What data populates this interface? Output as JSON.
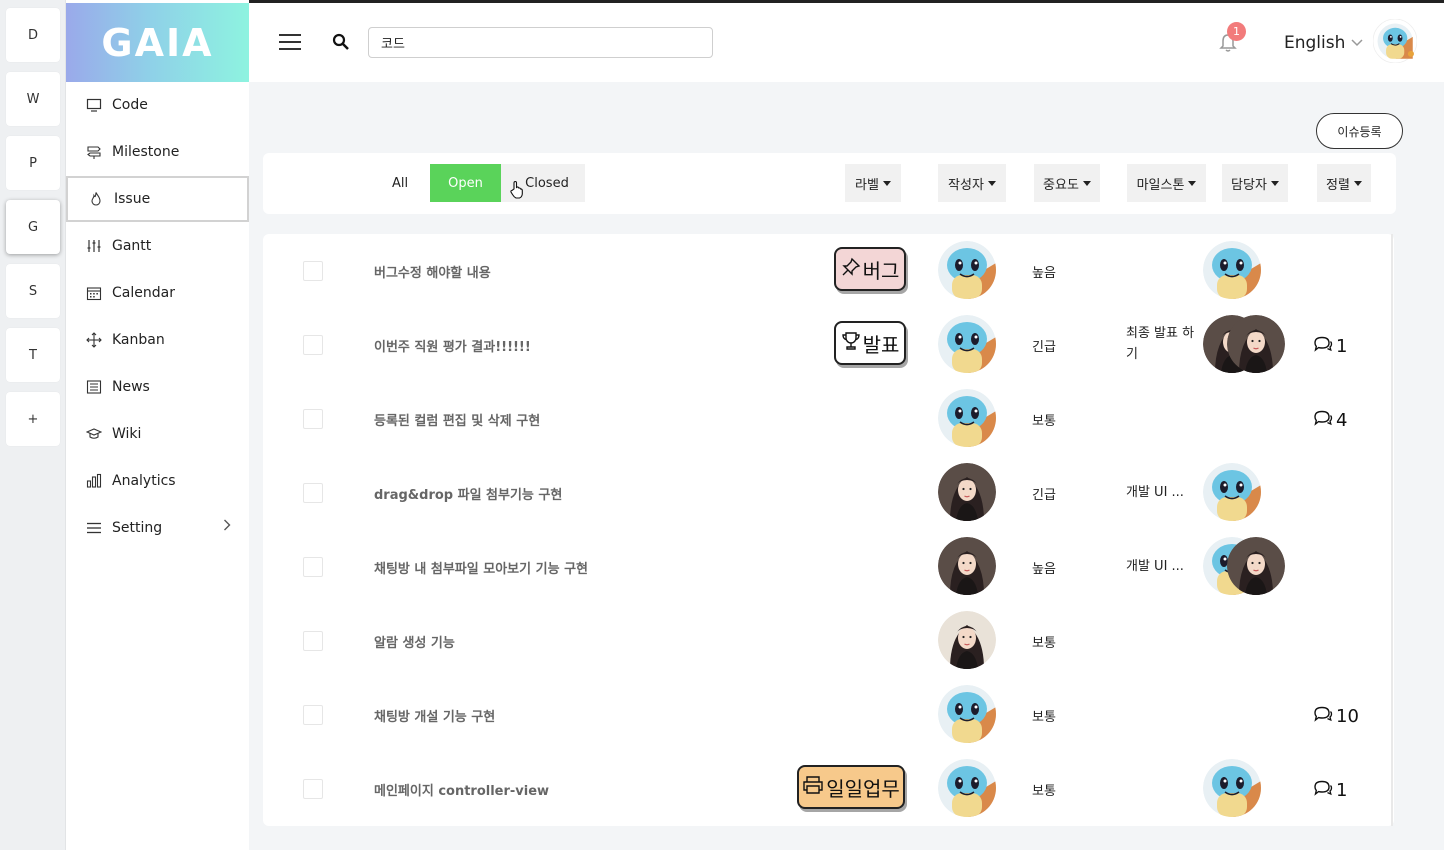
{
  "workspaces": [
    "D",
    "W",
    "P",
    "G",
    "S",
    "T",
    "+"
  ],
  "logo": "GAIA",
  "sidebar": {
    "items": [
      {
        "label": "Code",
        "icon": "monitor-icon"
      },
      {
        "label": "Milestone",
        "icon": "signpost-icon"
      },
      {
        "label": "Issue",
        "icon": "flame-icon"
      },
      {
        "label": "Gantt",
        "icon": "sliders-icon"
      },
      {
        "label": "Calendar",
        "icon": "calendar-icon"
      },
      {
        "label": "Kanban",
        "icon": "move-icon"
      },
      {
        "label": "News",
        "icon": "newspaper-icon"
      },
      {
        "label": "Wiki",
        "icon": "graduation-cap-icon"
      },
      {
        "label": "Analytics",
        "icon": "bar-chart-icon"
      },
      {
        "label": "Setting",
        "icon": "menu-icon"
      }
    ],
    "active": "Issue"
  },
  "topbar": {
    "search_value": "코드",
    "notification_count": "1",
    "language": "English"
  },
  "register_button": "이슈등록",
  "filters": {
    "all": "All",
    "open": "Open",
    "closed": "Closed",
    "dropdowns": [
      "라벨",
      "작성자",
      "중요도",
      "마일스톤",
      "담당자",
      "정렬"
    ]
  },
  "issues": [
    {
      "title": "버그수정 해야할 내용",
      "label": "버그",
      "label_icon": "pin-icon",
      "label_color": "#f3d6d6",
      "author": "squirtle",
      "priority": "높음",
      "milestone": "",
      "assignees": [
        "squirtle"
      ],
      "comments": ""
    },
    {
      "title": "이번주 직원 평가 결과!!!!!!",
      "label": "발표",
      "label_icon": "trophy-icon",
      "label_color": "#ffffff",
      "author": "squirtle",
      "priority": "긴급",
      "milestone": "최종 발표 하기",
      "assignees": [
        "person",
        "person"
      ],
      "comments": "1"
    },
    {
      "title": "등록된 컬럼 편집 및 삭제 구현",
      "label": "",
      "author": "squirtle",
      "priority": "보통",
      "milestone": "",
      "assignees": [],
      "comments": "4"
    },
    {
      "title": "drag&drop 파일 첨부기능 구현",
      "label": "",
      "author": "person",
      "priority": "긴급",
      "milestone": "개발 UI ...",
      "assignees": [
        "squirtle"
      ],
      "comments": ""
    },
    {
      "title": "채팅방 내 첨부파일 모아보기 기능 구현",
      "label": "",
      "author": "person",
      "priority": "높음",
      "milestone": "개발 UI ...",
      "assignees": [
        "squirtle",
        "person"
      ],
      "comments": ""
    },
    {
      "title": "알람 생성 기능",
      "label": "",
      "author": "person2",
      "priority": "보통",
      "milestone": "",
      "assignees": [],
      "comments": ""
    },
    {
      "title": "채팅방 개설 기능 구현",
      "label": "",
      "author": "squirtle",
      "priority": "보통",
      "milestone": "",
      "assignees": [],
      "comments": "10"
    },
    {
      "title": "메인페이지 controller-view",
      "label": "일일업무",
      "label_icon": "printer-icon",
      "label_color": "#f7c98b",
      "author": "squirtle",
      "priority": "보통",
      "milestone": "",
      "assignees": [
        "squirtle"
      ],
      "comments": "1"
    }
  ]
}
